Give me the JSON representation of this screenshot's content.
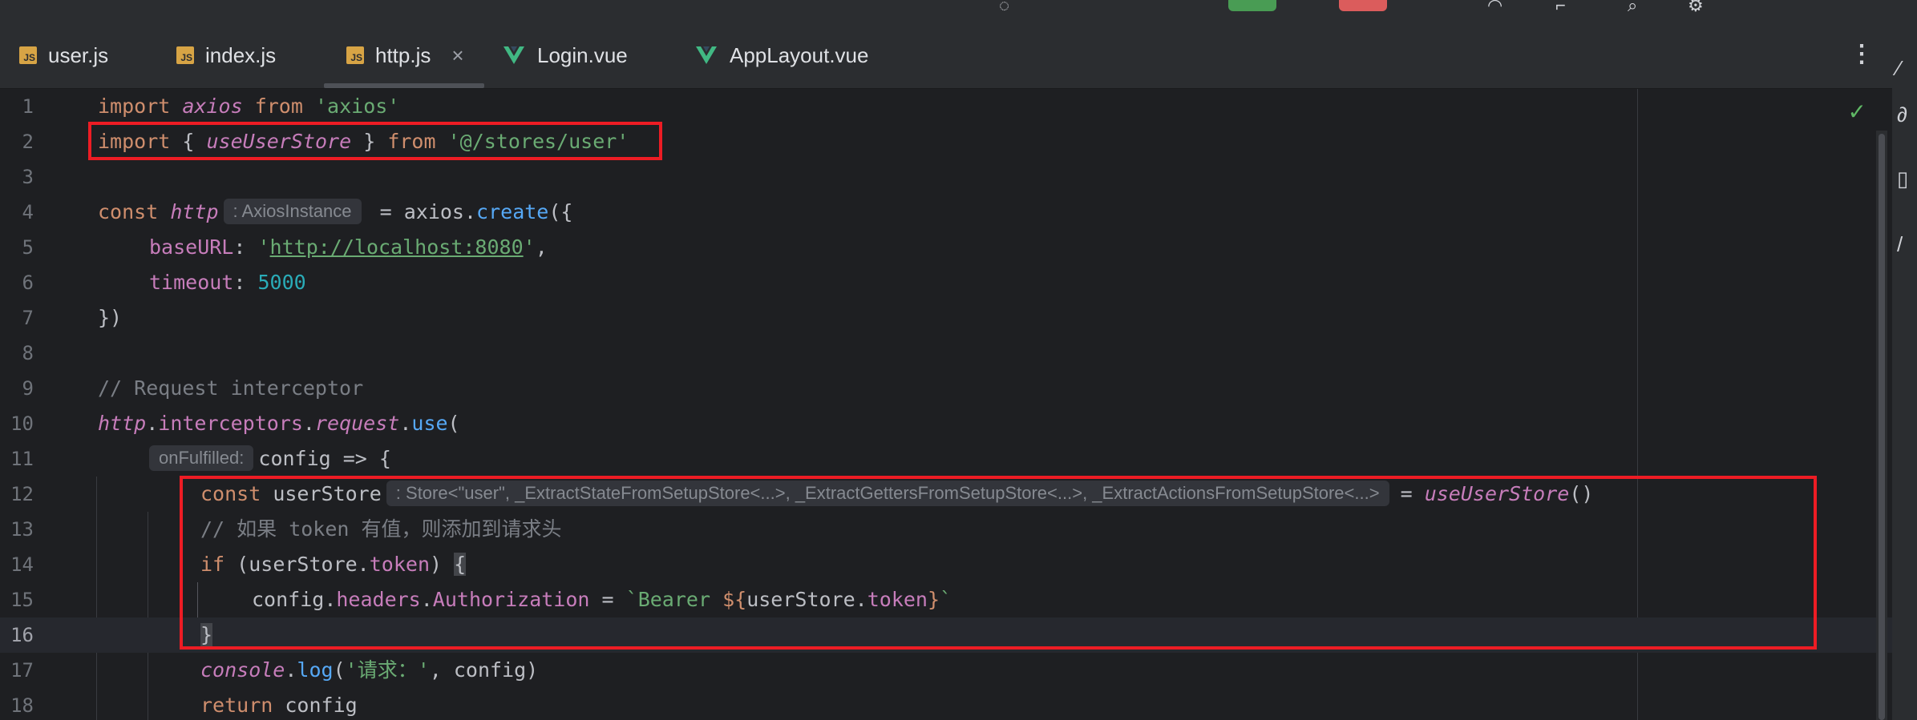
{
  "colors": {
    "background": "#1e1f22",
    "chrome": "#2b2d30",
    "annotation_red": "#ed1c24",
    "keyword": "#cf8e6d",
    "string": "#6aab73",
    "number": "#2aacb8",
    "function": "#56a8f5",
    "property": "#c77dbb",
    "comment": "#7a7e85"
  },
  "tabs": [
    {
      "label": "user.js",
      "icon": "js-file-icon"
    },
    {
      "label": "index.js",
      "icon": "js-file-icon"
    },
    {
      "label": "http.js",
      "icon": "js-file-icon",
      "active": true,
      "close": "×"
    },
    {
      "label": "Login.vue",
      "icon": "vue-file-icon"
    },
    {
      "label": "AppLayout.vue",
      "icon": "vue-file-icon"
    }
  ],
  "tab_menu_glyph": "⋮",
  "inspection_status_glyph": "✓",
  "line_numbers": [
    "1",
    "2",
    "3",
    "4",
    "5",
    "6",
    "7",
    "8",
    "9",
    "10",
    "11",
    "12",
    "13",
    "14",
    "15",
    "16",
    "17",
    "18"
  ],
  "current_line": "16",
  "code": {
    "l1": {
      "import": "import",
      "axios_it": "axios",
      "from": "from",
      "mod": "'axios'"
    },
    "l2": {
      "import": "import",
      "open": "{",
      "name": "useUserStore",
      "close": "}",
      "from": "from",
      "mod": "'@/stores/user'"
    },
    "l4": {
      "const": "const",
      "name": "http",
      "hint": ": AxiosInstance",
      "eq": "=",
      "obj": "axios",
      "dot": ".",
      "fn": "create",
      "open": "({"
    },
    "l5": {
      "key": "baseURL",
      "colon": ":",
      "q1": "'",
      "url": "http://localhost:8080",
      "q2": "'",
      "comma": ","
    },
    "l6": {
      "key": "timeout",
      "colon": ":",
      "val": "5000"
    },
    "l7": {
      "text": "})"
    },
    "l9": {
      "comment": "// Request interceptor"
    },
    "l10": {
      "obj": "http",
      "dot1": ".",
      "p1": "interceptors",
      "dot2": ".",
      "p2": "request",
      "dot3": ".",
      "fn": "use",
      "open": "("
    },
    "l11": {
      "hint": "onFulfilled:",
      "text": "config => {"
    },
    "l12": {
      "const": "const",
      "name": "userStore",
      "hint": ": Store<\"user\", _ExtractStateFromSetupStore<...>, _ExtractGettersFromSetupStore<...>, _ExtractActionsFromSetupStore<...>",
      "eq": "=",
      "fn": "useUserStore",
      "call": "()"
    },
    "l13": {
      "comment": "// 如果 token 有值，则添加到请求头"
    },
    "l14": {
      "if": "if",
      "open": "(userStore.",
      "prop": "token",
      "close": ")",
      "brace": "{"
    },
    "l15": {
      "obj": "config",
      "dot1": ".",
      "p1": "headers",
      "dot2": ".",
      "p2": "Authorization",
      "eq": "=",
      "tpl1": "`Bearer ",
      "interp_open": "${",
      "tobj": "userStore",
      "tdot": ".",
      "tprop": "token",
      "interp_close": "}",
      "tpl2": "`"
    },
    "l16": {
      "brace": "}"
    },
    "l17": {
      "obj": "console",
      "dot": ".",
      "fn": "log",
      "open": "(",
      "str": "'请求：'",
      "rest": ", config)"
    },
    "l18": {
      "ret": "return",
      "val": "config"
    }
  }
}
